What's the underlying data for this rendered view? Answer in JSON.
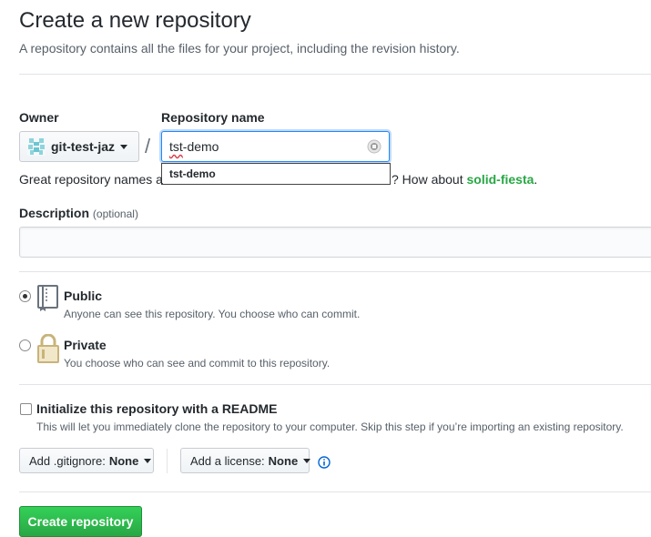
{
  "header": {
    "title": "Create a new repository",
    "subtitle": "A repository contains all the files for your project, including the revision history."
  },
  "owner": {
    "label": "Owner",
    "selected": "git-test-jaz"
  },
  "separator": "/",
  "repo_name": {
    "label": "Repository name",
    "value_misspelled": "tst",
    "value_rest": "-demo",
    "autocomplete": "tst-demo"
  },
  "hint": {
    "left": "Great repository names a",
    "right": "? How about ",
    "suggestion": "solid-fiesta",
    "end": "."
  },
  "description": {
    "label": "Description",
    "optional": "(optional)",
    "value": ""
  },
  "visibility": {
    "public": {
      "title": "Public",
      "desc": "Anyone can see this repository. You choose who can commit.",
      "selected": true
    },
    "private": {
      "title": "Private",
      "desc": "You choose who can see and commit to this repository.",
      "selected": false
    }
  },
  "init": {
    "title": "Initialize this repository with a README",
    "desc": "This will let you immediately clone the repository to your computer. Skip this step if you’re importing an existing repository.",
    "checked": false
  },
  "gitignore": {
    "label": "Add .gitignore:",
    "value": "None"
  },
  "license": {
    "label": "Add a license:",
    "value": "None"
  },
  "submit": {
    "label": "Create repository"
  },
  "colors": {
    "accent": "#2188ff",
    "suggestion": "#28a745",
    "create_button": "#28a745",
    "info_icon": "#0366d6"
  },
  "icons": {
    "owner_avatar": "identicon-avatar",
    "loading": "spinner-icon",
    "public": "repo-icon",
    "private": "lock-icon",
    "info": "info-icon"
  }
}
